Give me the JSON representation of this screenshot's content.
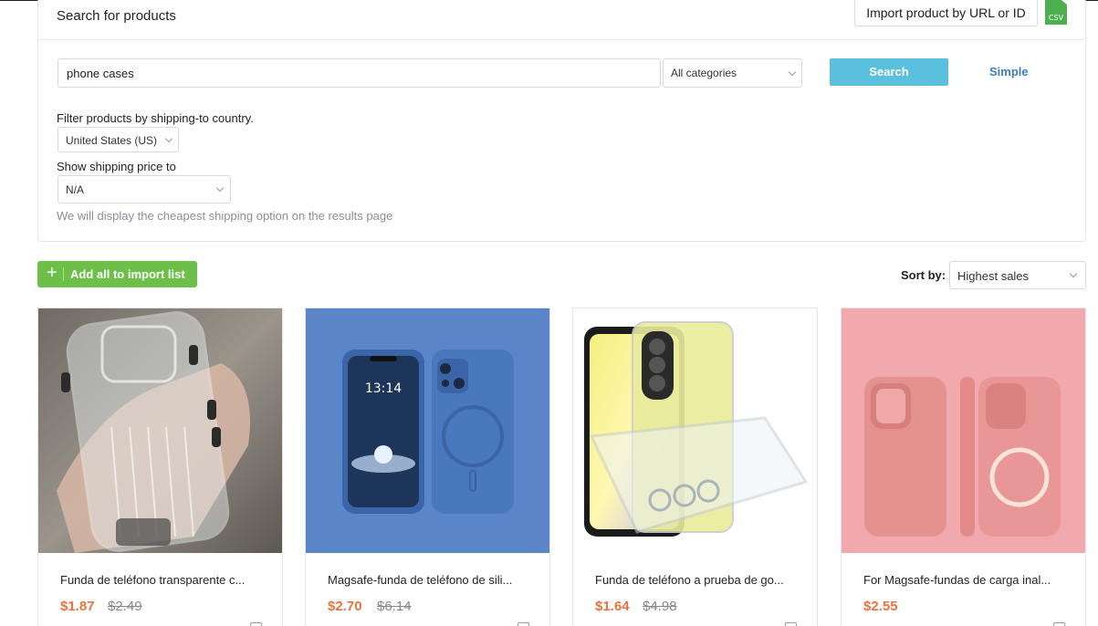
{
  "search_panel": {
    "title": "Search for products",
    "import_button": "Import product by URL or ID",
    "csv_label": "CSV",
    "query": "phone cases",
    "category": "All categories",
    "search_button": "Search",
    "simple_link": "Simple",
    "filter_label": "Filter products by shipping-to country.",
    "country": "United States (US)",
    "ship_label": "Show shipping price to",
    "ship_value": "N/A",
    "ship_hint": "We will display the cheapest shipping option on the results page"
  },
  "toolbar": {
    "add_all": "Add all to import list",
    "sort_label": "Sort by:",
    "sort_value": "Highest sales"
  },
  "products": [
    {
      "title": "Funda de teléfono transparente c...",
      "price": "$1.87",
      "old_price": "$2.49"
    },
    {
      "title": "Magsafe-funda de teléfono de sili...",
      "price": "$2.70",
      "old_price": "$6.14"
    },
    {
      "title": "Funda de teléfono a prueba de go...",
      "price": "$1.64",
      "old_price": "$4.98"
    },
    {
      "title": "For Magsafe-fundas de carga inal...",
      "price": "$2.55",
      "old_price": ""
    }
  ],
  "phone_screen_time": "13:14",
  "colors": {
    "accent_blue": "#5bc0de",
    "green": "#6cc04a",
    "price_orange": "#e8733e"
  }
}
